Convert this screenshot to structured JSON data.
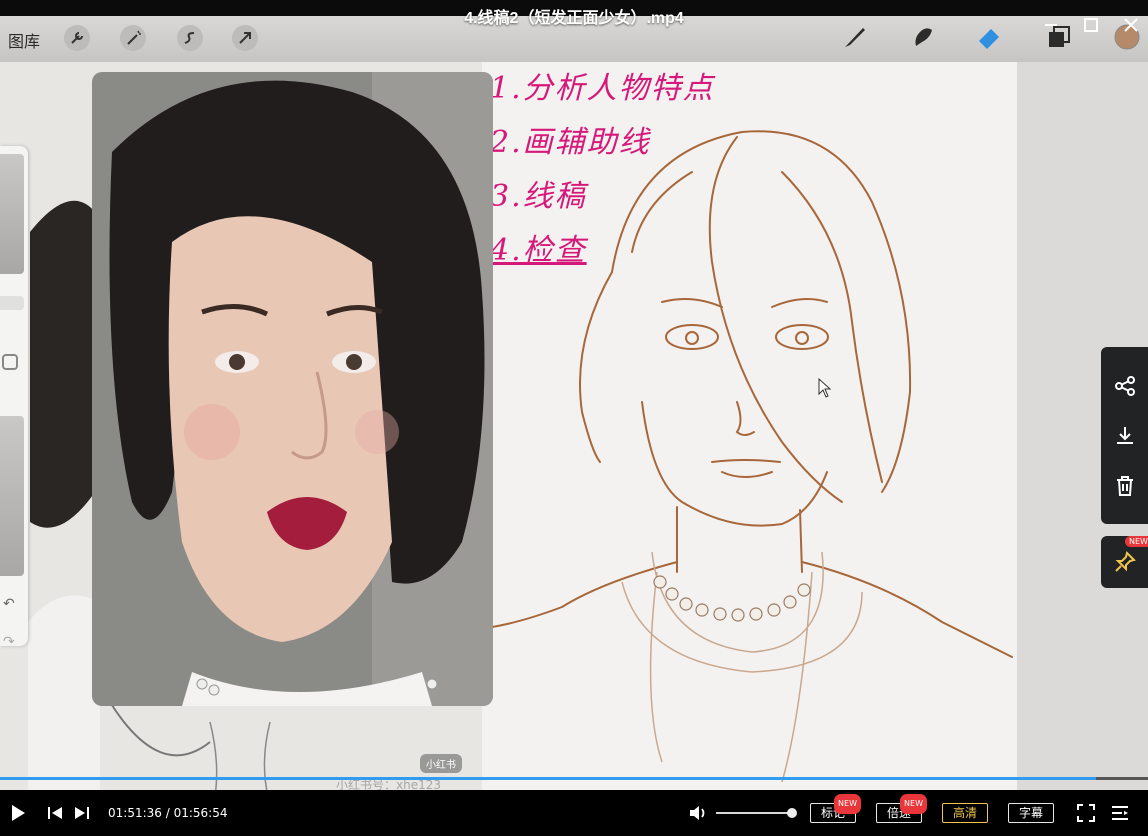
{
  "window": {
    "title": "4.线稿2（短发正面少女）.mp4",
    "controls": [
      "minimize-icon",
      "maximize-icon",
      "close-icon"
    ]
  },
  "procreate": {
    "gallery_label": "图库",
    "tools_left": [
      "wrench-icon",
      "magic-wand-icon",
      "selection-icon",
      "transform-arrow-icon"
    ],
    "tools_right": [
      "brush-icon",
      "smudge-icon",
      "eraser-icon",
      "layers-icon",
      "color-icon"
    ],
    "color_swatch": "#b58a6a"
  },
  "notes": {
    "line1": "1.分析人物特点",
    "line2": "2.画辅助线",
    "line3": "3.线稿",
    "line4": "4.检查"
  },
  "watermark": {
    "badge": "小红书",
    "text": "小红书号：xhe123"
  },
  "side_actions": {
    "share": "share-icon",
    "download": "download-icon",
    "delete": "trash-icon",
    "pin": "pin-icon",
    "pin_badge": "NEW"
  },
  "player": {
    "current_time": "01:51:36",
    "total_time": "01:56:54",
    "time_display": "01:51:36 / 01:56:54",
    "progress_fraction": 0.9548,
    "volume_fraction": 1.0,
    "buttons": {
      "mark": "标记",
      "mark_badge": "NEW",
      "speed": "倍速",
      "speed_badge": "NEW",
      "quality": "高清",
      "subtitle": "字幕"
    },
    "colors": {
      "progress": "#2f9cf0",
      "quality": "#f0c64c"
    }
  }
}
